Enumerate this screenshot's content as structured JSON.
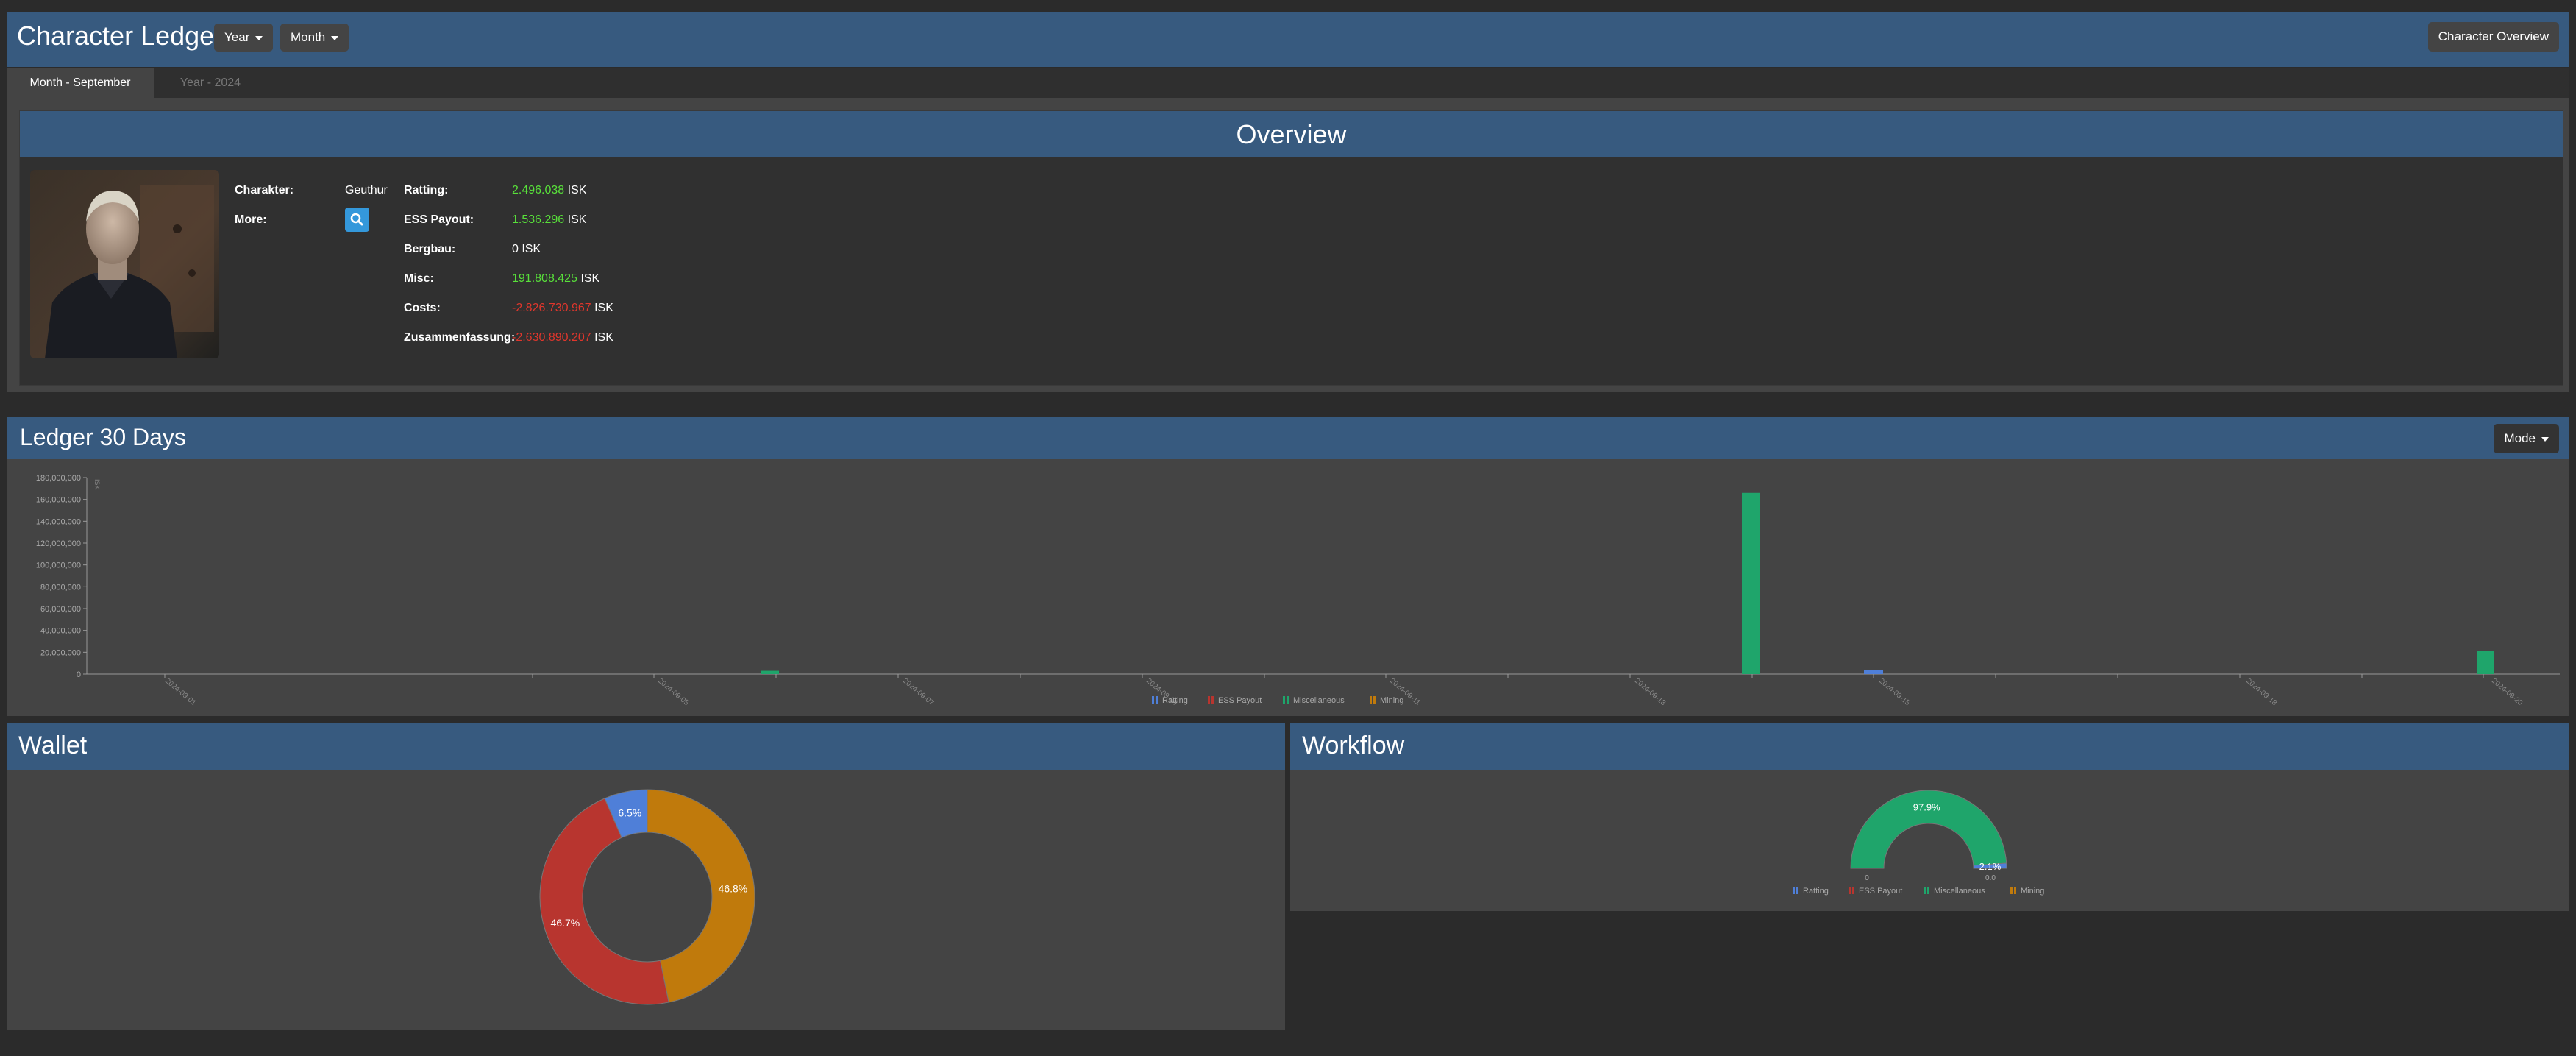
{
  "app": {
    "title": "Character Ledger"
  },
  "filters": {
    "year_label": "Year",
    "month_label": "Month"
  },
  "header_right": {
    "character_overview_label": "Character Overview"
  },
  "tabs": [
    {
      "label": "Month - September"
    },
    {
      "label": "Year - 2024"
    }
  ],
  "overview": {
    "title": "Overview",
    "character_label": "Charakter:",
    "character_name": "Geuthur",
    "more_label": "More:",
    "rows": [
      {
        "label": "Ratting:",
        "value": "2.496.038",
        "unit": "ISK",
        "sign": "pos"
      },
      {
        "label": "ESS Payout:",
        "value": "1.536.296",
        "unit": "ISK",
        "sign": "pos"
      },
      {
        "label": "Bergbau:",
        "value": "0",
        "unit": "ISK",
        "sign": "zero"
      },
      {
        "label": "Misc:",
        "value": "191.808.425",
        "unit": "ISK",
        "sign": "pos"
      },
      {
        "label": "Costs:",
        "value": "-2.826.730.967",
        "unit": "ISK",
        "sign": "neg"
      },
      {
        "label": "Zusammenfassung:",
        "value": "-2.630.890.207",
        "unit": "ISK",
        "sign": "neg"
      }
    ]
  },
  "ledger": {
    "title": "Ledger 30 Days",
    "mode_label": "Mode"
  },
  "legend": [
    {
      "name": "Ratting",
      "color": "#4f7fd8"
    },
    {
      "name": "ESS Payout",
      "color": "#b8352f"
    },
    {
      "name": "Miscellaneous",
      "color": "#1fa56b"
    },
    {
      "name": "Mining",
      "color": "#c07a0c"
    }
  ],
  "wallet": {
    "title": "Wallet"
  },
  "workflow": {
    "title": "Workflow"
  },
  "chart_data": [
    {
      "type": "bar",
      "ylabel": "ISK",
      "ylim": [
        0,
        180000000
      ],
      "yticks": [
        "0",
        "20,000,000",
        "40,000,000",
        "60,000,000",
        "80,000,000",
        "100,000,000",
        "120,000,000",
        "140,000,000",
        "160,000,000",
        "180,000,000"
      ],
      "xticks": [
        "2024-09-01",
        "2024-09-05",
        "2024-09-07",
        "2024-09-09",
        "2024-09-11",
        "2024-09-13",
        "2024-09-15",
        "2024-09-18",
        "2024-09-20"
      ],
      "bars": [
        {
          "date": "2024-09-06",
          "series": "Miscellaneous",
          "value": 3000000
        },
        {
          "date": "2024-09-14",
          "series": "Miscellaneous",
          "value": 166000000
        },
        {
          "date": "2024-09-15",
          "series": "Ratting",
          "value": 4000000
        },
        {
          "date": "2024-09-20",
          "series": "Miscellaneous",
          "value": 21000000
        }
      ]
    },
    {
      "type": "pie",
      "title": "Wallet",
      "slices": [
        {
          "name": "Ratting",
          "value": 6.5,
          "label": "6.5%"
        },
        {
          "name": "Mining",
          "value": 46.8,
          "label": "46.8%"
        },
        {
          "name": "ESS Payout",
          "value": 46.7,
          "label": "46.7%"
        }
      ]
    },
    {
      "type": "pie",
      "title": "Workflow",
      "gauge_labels": [
        "0",
        "0.0"
      ],
      "slices": [
        {
          "name": "Miscellaneous",
          "value": 97.9,
          "label": "97.9%"
        },
        {
          "name": "Ratting",
          "value": 2.1,
          "label": "2.1%"
        }
      ]
    }
  ]
}
